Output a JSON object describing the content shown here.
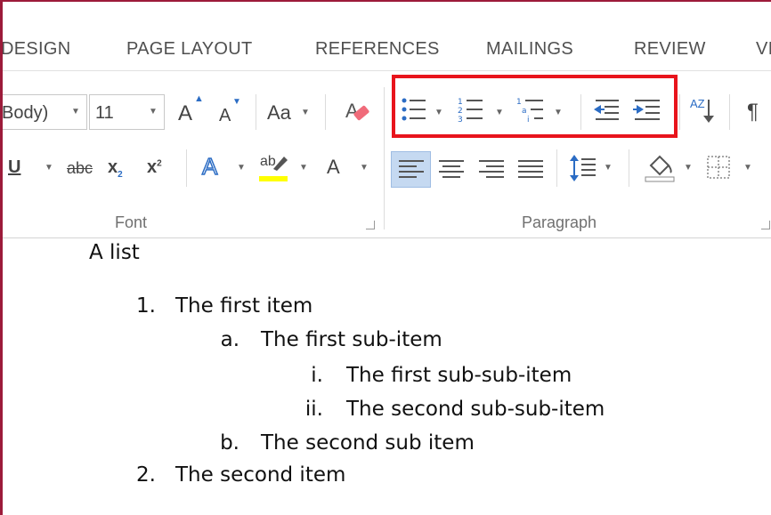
{
  "tabs": [
    "DESIGN",
    "PAGE LAYOUT",
    "REFERENCES",
    "MAILINGS",
    "REVIEW",
    "VI"
  ],
  "font_group": {
    "font_name": "Body)",
    "font_size": "11",
    "grow_font": "A",
    "shrink_font": "A",
    "change_case": "Aa",
    "underline": "U",
    "strikethrough": "abc",
    "subscript": "x",
    "subscript_mark": "2",
    "superscript": "x",
    "superscript_mark": "2",
    "text_effects": "A",
    "highlight": "ab",
    "font_color": "A",
    "label": "Font"
  },
  "paragraph_group": {
    "label": "Paragraph",
    "sort": "AZ",
    "pilcrow": "¶"
  },
  "document": {
    "heading": "A list",
    "items": [
      {
        "marker": "1.",
        "text": "The first item"
      },
      {
        "marker": "a.",
        "text": "The first sub-item"
      },
      {
        "marker": "i.",
        "text": "The first sub-sub-item"
      },
      {
        "marker": "ii.",
        "text": "The second sub-sub-item"
      },
      {
        "marker": "b.",
        "text": "The second sub item"
      },
      {
        "marker": "2.",
        "text": "The second item"
      }
    ]
  },
  "colors": {
    "highlight_box": "#e8141c",
    "window_border": "#9c1b3a",
    "text_highlight": "#ffff00",
    "icon_blue": "#2b6cc4"
  }
}
